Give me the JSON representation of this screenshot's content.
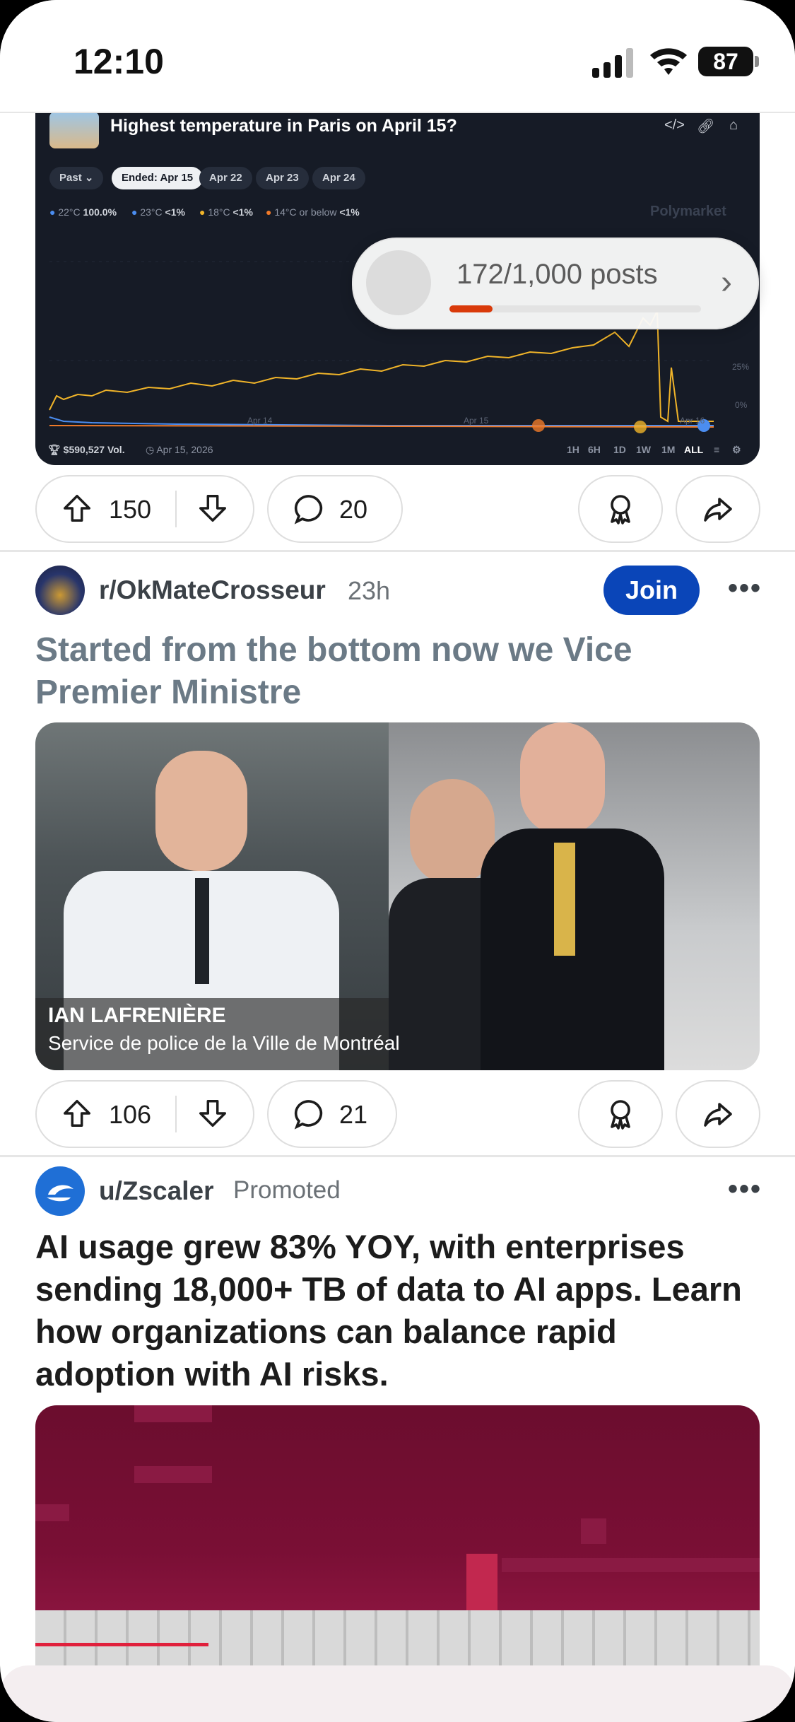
{
  "status_bar": {
    "time": "12:10",
    "battery": "87"
  },
  "embed": {
    "title": "Highest temperature in Paris on April 15?",
    "pills": [
      "Past ⌄",
      "Ended: Apr 15",
      "Apr 22",
      "Apr 23",
      "Apr 24"
    ],
    "legend": [
      {
        "label": "22°C",
        "value": "100.0%",
        "color": "#4b8df0"
      },
      {
        "label": "23°C",
        "value": "<1%",
        "color": "#4b8df0"
      },
      {
        "label": "18°C",
        "value": "<1%",
        "color": "#f0b429"
      },
      {
        "label": "14°C or below",
        "value": "<1%",
        "color": "#f07a29"
      }
    ],
    "watermark": "Polymarket",
    "y_ticks": [
      "25%",
      "0%"
    ],
    "x_ticks": [
      "Apr 14",
      "Apr 15",
      "Apr 16"
    ],
    "volume": "$590,527 Vol.",
    "date": "Apr 15, 2026",
    "timeframes": [
      "1H",
      "6H",
      "1D",
      "1W",
      "1M",
      "ALL"
    ],
    "selected_timeframe": "ALL"
  },
  "progress": {
    "text": "172/1,000 posts",
    "fraction": 0.172
  },
  "post1": {
    "votes": "150",
    "comments": "20"
  },
  "post2": {
    "subreddit": "r/OkMateCrosseur",
    "age": "23h",
    "join_label": "Join",
    "title": "Started from the bottom now we Vice Premier Ministre",
    "caption_name": "IAN LAFRENIÈRE",
    "caption_org": "Service de police de la Ville de Montréal",
    "votes": "106",
    "comments": "21"
  },
  "post3": {
    "user": "u/Zscaler",
    "tag": "Promoted",
    "title": "AI usage grew 83% YOY, with enterprises sending 18,000+ TB of data to AI apps. Learn how organizations can balance rapid adoption with AI risks."
  },
  "colors": {
    "accent": "#0a45b8",
    "orange": "#d93a0a"
  }
}
